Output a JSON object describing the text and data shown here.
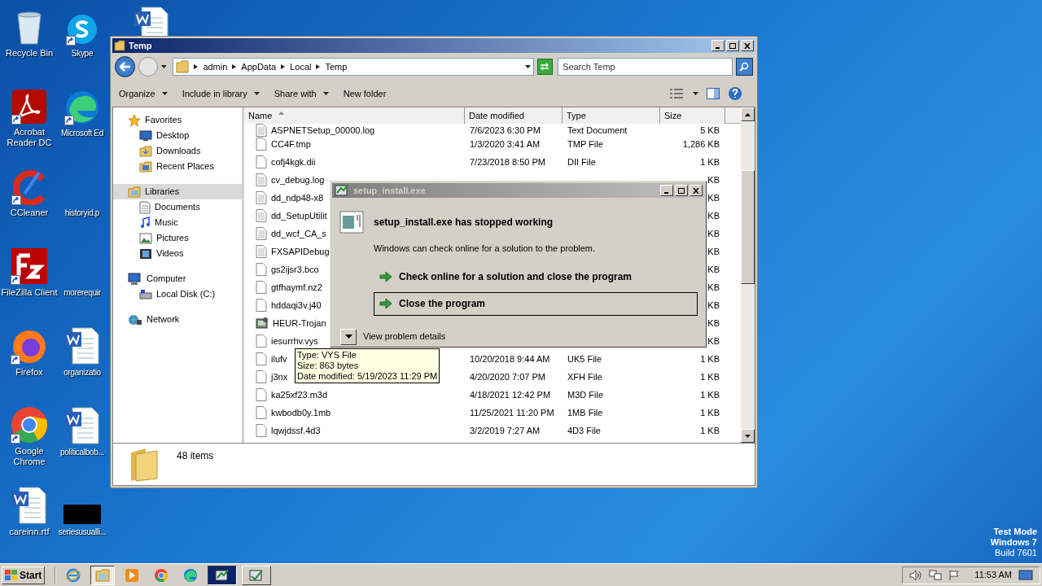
{
  "desktop_icons": [
    {
      "label": "Recycle Bin",
      "kind": "recycle"
    },
    {
      "label": "Skype",
      "kind": "skype"
    },
    {
      "label": "Acrobat Reader DC",
      "kind": "acrobat"
    },
    {
      "label": "Microsoft Ed",
      "kind": "edge"
    },
    {
      "label": "CCleaner",
      "kind": "ccleaner"
    },
    {
      "label": "historyid.p",
      "kind": "blank"
    },
    {
      "label": "FileZilla Client",
      "kind": "filezilla"
    },
    {
      "label": "morerequir",
      "kind": "blank"
    },
    {
      "label": "Firefox",
      "kind": "firefox"
    },
    {
      "label": "organizatio",
      "kind": "word"
    },
    {
      "label": "Google Chrome",
      "kind": "chrome"
    },
    {
      "label": "politicalbob...",
      "kind": "word"
    },
    {
      "label": "careinn.rtf",
      "kind": "word"
    },
    {
      "label": "seriesusualli...",
      "kind": "black"
    }
  ],
  "explorer": {
    "title": "Temp",
    "breadcrumb": [
      "admin",
      "AppData",
      "Local",
      "Temp"
    ],
    "search": {
      "placeholder": "Search Temp"
    },
    "toolbar": [
      {
        "label": "Organize",
        "dropdown": true
      },
      {
        "label": "Include in library",
        "dropdown": true
      },
      {
        "label": "Share with",
        "dropdown": true
      },
      {
        "label": "New folder",
        "dropdown": false
      }
    ],
    "nav": [
      {
        "label": "Favorites",
        "selected": false,
        "children": [
          {
            "label": "Desktop",
            "selected": false
          },
          {
            "label": "Downloads",
            "selected": false
          },
          {
            "label": "Recent Places",
            "selected": false
          }
        ]
      },
      {
        "label": "Libraries",
        "selected": true,
        "children": [
          {
            "label": "Documents",
            "selected": false
          },
          {
            "label": "Music",
            "selected": false
          },
          {
            "label": "Pictures",
            "selected": false
          },
          {
            "label": "Videos",
            "selected": false
          }
        ]
      },
      {
        "label": "Computer",
        "selected": false,
        "children": [
          {
            "label": "Local Disk (C:)",
            "selected": false
          }
        ]
      },
      {
        "label": "Network",
        "selected": false
      }
    ],
    "columns": [
      {
        "label": "Name",
        "sorted": true
      },
      {
        "label": "Date modified",
        "sorted": false
      },
      {
        "label": "Type",
        "sorted": false
      },
      {
        "label": "Size",
        "sorted": false
      }
    ],
    "rows": [
      {
        "kind": "text",
        "name": "ASPNETSetup_00000.log",
        "date": "7/6/2023 6:30 PM",
        "type": "Text Document",
        "size": "5 KB"
      },
      {
        "kind": "blank",
        "name": "CC4F.tmp",
        "date": "1/3/2020 3:41 AM",
        "type": "TMP File",
        "size": "1,286 KB"
      },
      {
        "kind": "blank",
        "name": "cofj4kgk.dii",
        "date": "7/23/2018 8:50 PM",
        "type": "DII File",
        "size": "1 KB"
      },
      {
        "kind": "text",
        "name": "cv_debug.log",
        "size": "KB"
      },
      {
        "kind": "text",
        "name": "dd_ndp48-x8",
        "size": "KB"
      },
      {
        "kind": "text",
        "name": "dd_SetupUtilit",
        "size": "KB"
      },
      {
        "kind": "text",
        "name": "dd_wcf_CA_s",
        "size": "KB"
      },
      {
        "kind": "text",
        "name": "FXSAPIDebug",
        "size": "KB"
      },
      {
        "kind": "blank",
        "name": "gs2ijsr3.bco",
        "size": "KB"
      },
      {
        "kind": "blank",
        "name": "gtfhaymf.nz2",
        "size": "KB"
      },
      {
        "kind": "blank",
        "name": "hddaqi3v.j40",
        "size": "KB"
      },
      {
        "kind": "exe",
        "name": "HEUR-Trojan",
        "size": "KB"
      },
      {
        "kind": "blank",
        "name": "iesurrhv.vys",
        "size": "KB"
      },
      {
        "kind": "blank",
        "name": "ilufv",
        "date": "10/20/2018 9:44 AM",
        "type": "UK5 File",
        "size": "1 KB"
      },
      {
        "kind": "blank",
        "name": "j3nx",
        "date": "4/20/2020 7:07 PM",
        "type": "XFH File",
        "size": "1 KB"
      },
      {
        "kind": "blank",
        "name": "ka25xf23.m3d",
        "date": "4/18/2021 12:42 PM",
        "type": "M3D File",
        "size": "1 KB"
      },
      {
        "kind": "blank",
        "name": "kwbodb0y.1mb",
        "date": "11/25/2021 11:20 PM",
        "type": "1MB File",
        "size": "1 KB"
      },
      {
        "kind": "blank",
        "name": "lqwjdssf.4d3",
        "date": "3/2/2019 7:27 AM",
        "type": "4D3 File",
        "size": "1 KB"
      }
    ],
    "status": "48 items"
  },
  "tooltip": [
    "Type: VYS File",
    "Size: 863 bytes",
    "Date modified: 5/19/2023 11:29 PM"
  ],
  "dialog": {
    "title": "setup_install.exe",
    "heading": "setup_install.exe has stopped working",
    "message": "Windows can check online for a solution to the problem.",
    "options": [
      {
        "label": "Check online for a solution and close the program",
        "selected": false
      },
      {
        "label": "Close the program",
        "selected": true
      }
    ],
    "details": {
      "label": "View problem details",
      "expanded": false
    }
  },
  "watermark_text": [
    "Test Mode",
    "Windows 7",
    "Build 7601"
  ],
  "taskbar": {
    "start": "Start",
    "items": [
      {
        "kind": "ie",
        "selected": false
      },
      {
        "kind": "explorer",
        "selected": true
      },
      {
        "kind": "media",
        "selected": false
      },
      {
        "kind": "chrome",
        "selected": false
      },
      {
        "kind": "edge",
        "selected": false
      },
      {
        "kind": "task-setup",
        "selected": true
      },
      {
        "kind": "task-app",
        "selected": false
      }
    ],
    "clock": "11:53 AM"
  }
}
